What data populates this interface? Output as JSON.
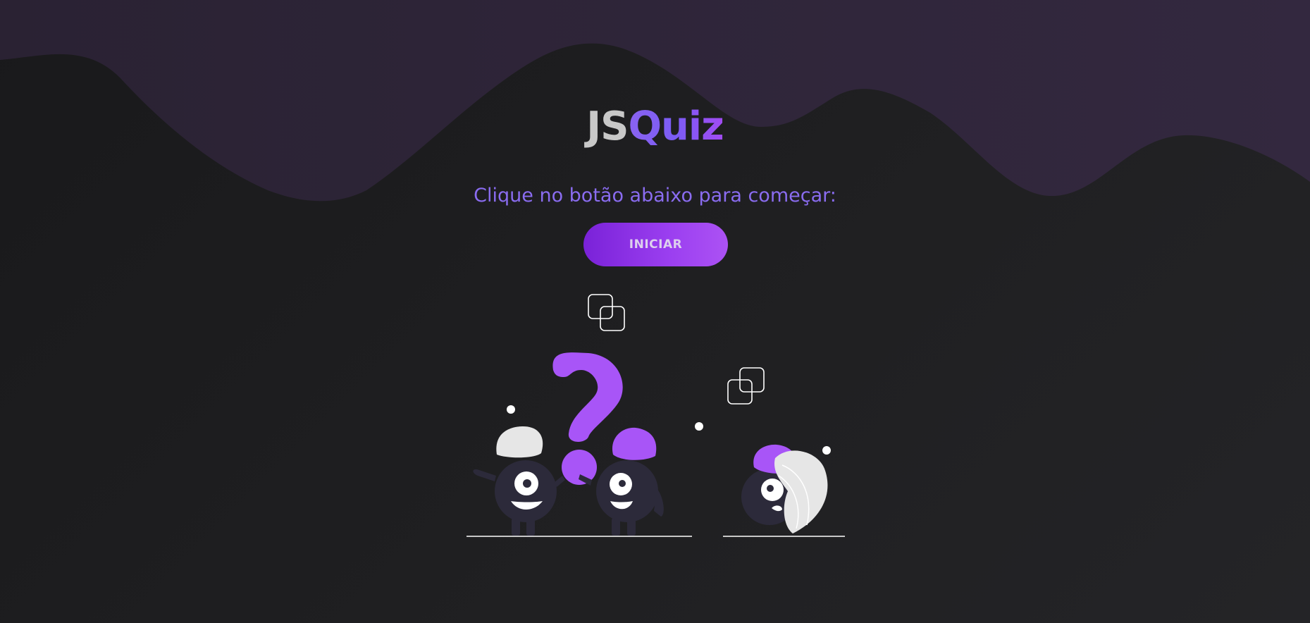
{
  "app": {
    "title_part1": "JS",
    "title_part2": "Quiz"
  },
  "intro": {
    "subtitle": "Clique no botão abaixo para começar:"
  },
  "actions": {
    "start_label": "INICIAR"
  },
  "colors": {
    "accent": "#a855f7",
    "title_light": "#c8c8c8",
    "subtitle": "#8a6cf0",
    "background": "#1c1c1e",
    "wave": "#2f2538"
  },
  "illustration": {
    "icon": "question-characters-illustration"
  }
}
